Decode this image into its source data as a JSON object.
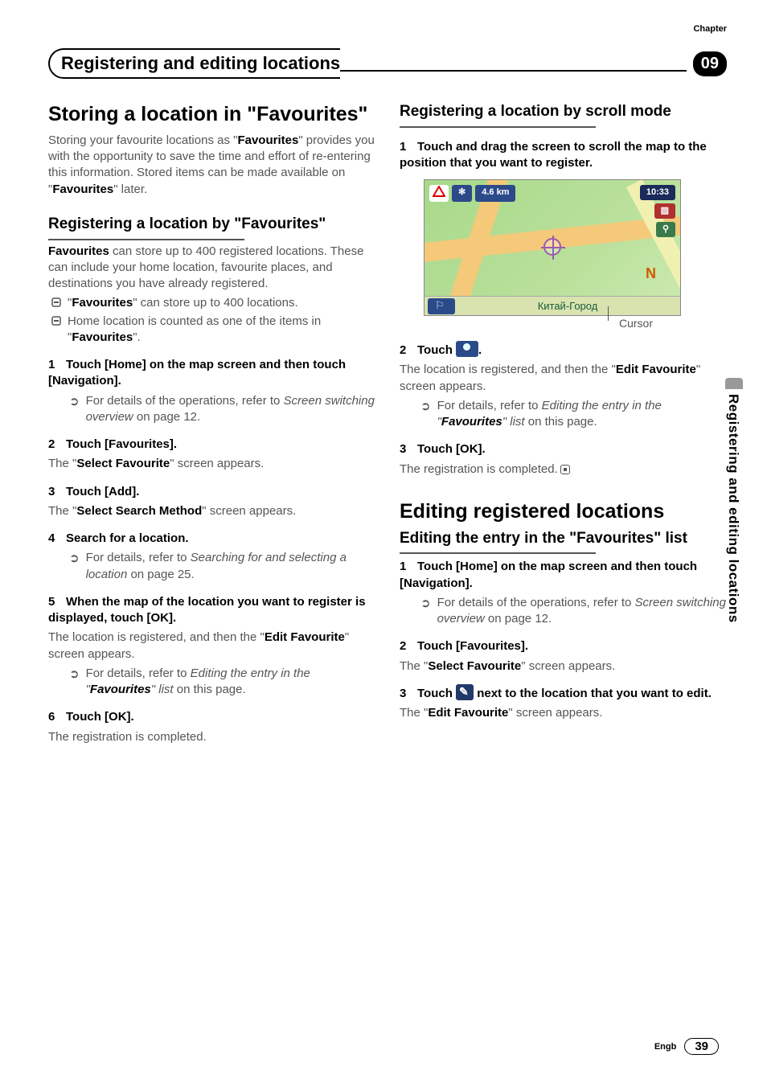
{
  "chapter_label": "Chapter",
  "chapter_number": "09",
  "header_title": "Registering and editing locations",
  "side_tab_text": "Registering and editing locations",
  "footer": {
    "lang": "Engb",
    "page": "39"
  },
  "left": {
    "h1": "Storing a location in \"Favourites\"",
    "intro_1": "Storing your favourite locations as \"",
    "intro_bold1": "Favourites",
    "intro_2": "\" provides you with the opportunity to save the time and effort of re-entering this information. Stored items can be made available on \"",
    "intro_bold2": "Favourites",
    "intro_3": "\" later.",
    "h2a": "Registering a location by \"Favourites\"",
    "p2_1": "Favourites",
    "p2_2": " can store up to 400 registered locations. These can include your home location, favourite places, and destinations you have already registered.",
    "b1_1": "\"",
    "b1_bold": "Favourites",
    "b1_2": "\" can store up to 400 locations.",
    "b2_1": "Home location is counted as one of the items in \"",
    "b2_bold": "Favourites",
    "b2_2": "\".",
    "s1_title": "Touch [Home] on the map screen and then touch [Navigation].",
    "s1_ref_1": "For details of the operations, refer to ",
    "s1_ref_ital": "Screen switching overview",
    "s1_ref_2": " on page 12.",
    "s2_title": "Touch [Favourites].",
    "s2_body_1": "The \"",
    "s2_body_bold": "Select Favourite",
    "s2_body_2": "\" screen appears.",
    "s3_title": "Touch [Add].",
    "s3_body_1": "The \"",
    "s3_body_bold": "Select Search Method",
    "s3_body_2": "\" screen appears.",
    "s4_title": "Search for a location.",
    "s4_ref_1": "For details, refer to ",
    "s4_ref_ital": "Searching for and selecting a location",
    "s4_ref_2": " on page 25.",
    "s5_title": "When the map of the location you want to register is displayed, touch [OK].",
    "s5_body_1": "The location is registered, and then the \"",
    "s5_body_bold": "Edit Favourite",
    "s5_body_2": "\" screen appears.",
    "s5_ref_1": "For details, refer to ",
    "s5_ref_ital": "Editing the entry in the \"",
    "s5_ref_bold": "Favourites",
    "s5_ref_ital2": "\" list",
    "s5_ref_2": " on this page.",
    "s6_title": "Touch [OK].",
    "s6_body": "The registration is completed."
  },
  "right": {
    "h2a": "Registering a location by scroll mode",
    "s1_title": "Touch and drag the screen to scroll the map to the position that you want to register.",
    "map": {
      "distance": "4.6 km",
      "time": "10:33",
      "bottom_text": "Китай-Город",
      "compass": "N"
    },
    "cursor_label": "Cursor",
    "s2_title_a": "Touch ",
    "s2_title_b": ".",
    "s2_body_1": "The location is registered, and then the \"",
    "s2_body_bold": "Edit Favourite",
    "s2_body_2": "\" screen appears.",
    "s2_ref_1": "For details, refer to ",
    "s2_ref_ital": "Editing the entry in the \"",
    "s2_ref_bold": "Favourites",
    "s2_ref_ital2": "\" list",
    "s2_ref_2": " on this page.",
    "s3_title": "Touch [OK].",
    "s3_body": "The registration is completed.",
    "h1b": "Editing registered locations",
    "h2b": "Editing the entry in the \"Favourites\" list",
    "e1_title": "Touch [Home] on the map screen and then touch [Navigation].",
    "e1_ref_1": "For details of the operations, refer to ",
    "e1_ref_ital": "Screen switching overview",
    "e1_ref_2": " on page 12.",
    "e2_title": "Touch [Favourites].",
    "e2_body_1": "The \"",
    "e2_body_bold": "Select Favourite",
    "e2_body_2": "\" screen appears.",
    "e3_title_a": "Touch ",
    "e3_title_b": " next to the location that you want to edit.",
    "e3_body_1": "The \"",
    "e3_body_bold": "Edit Favourite",
    "e3_body_2": "\" screen appears."
  }
}
